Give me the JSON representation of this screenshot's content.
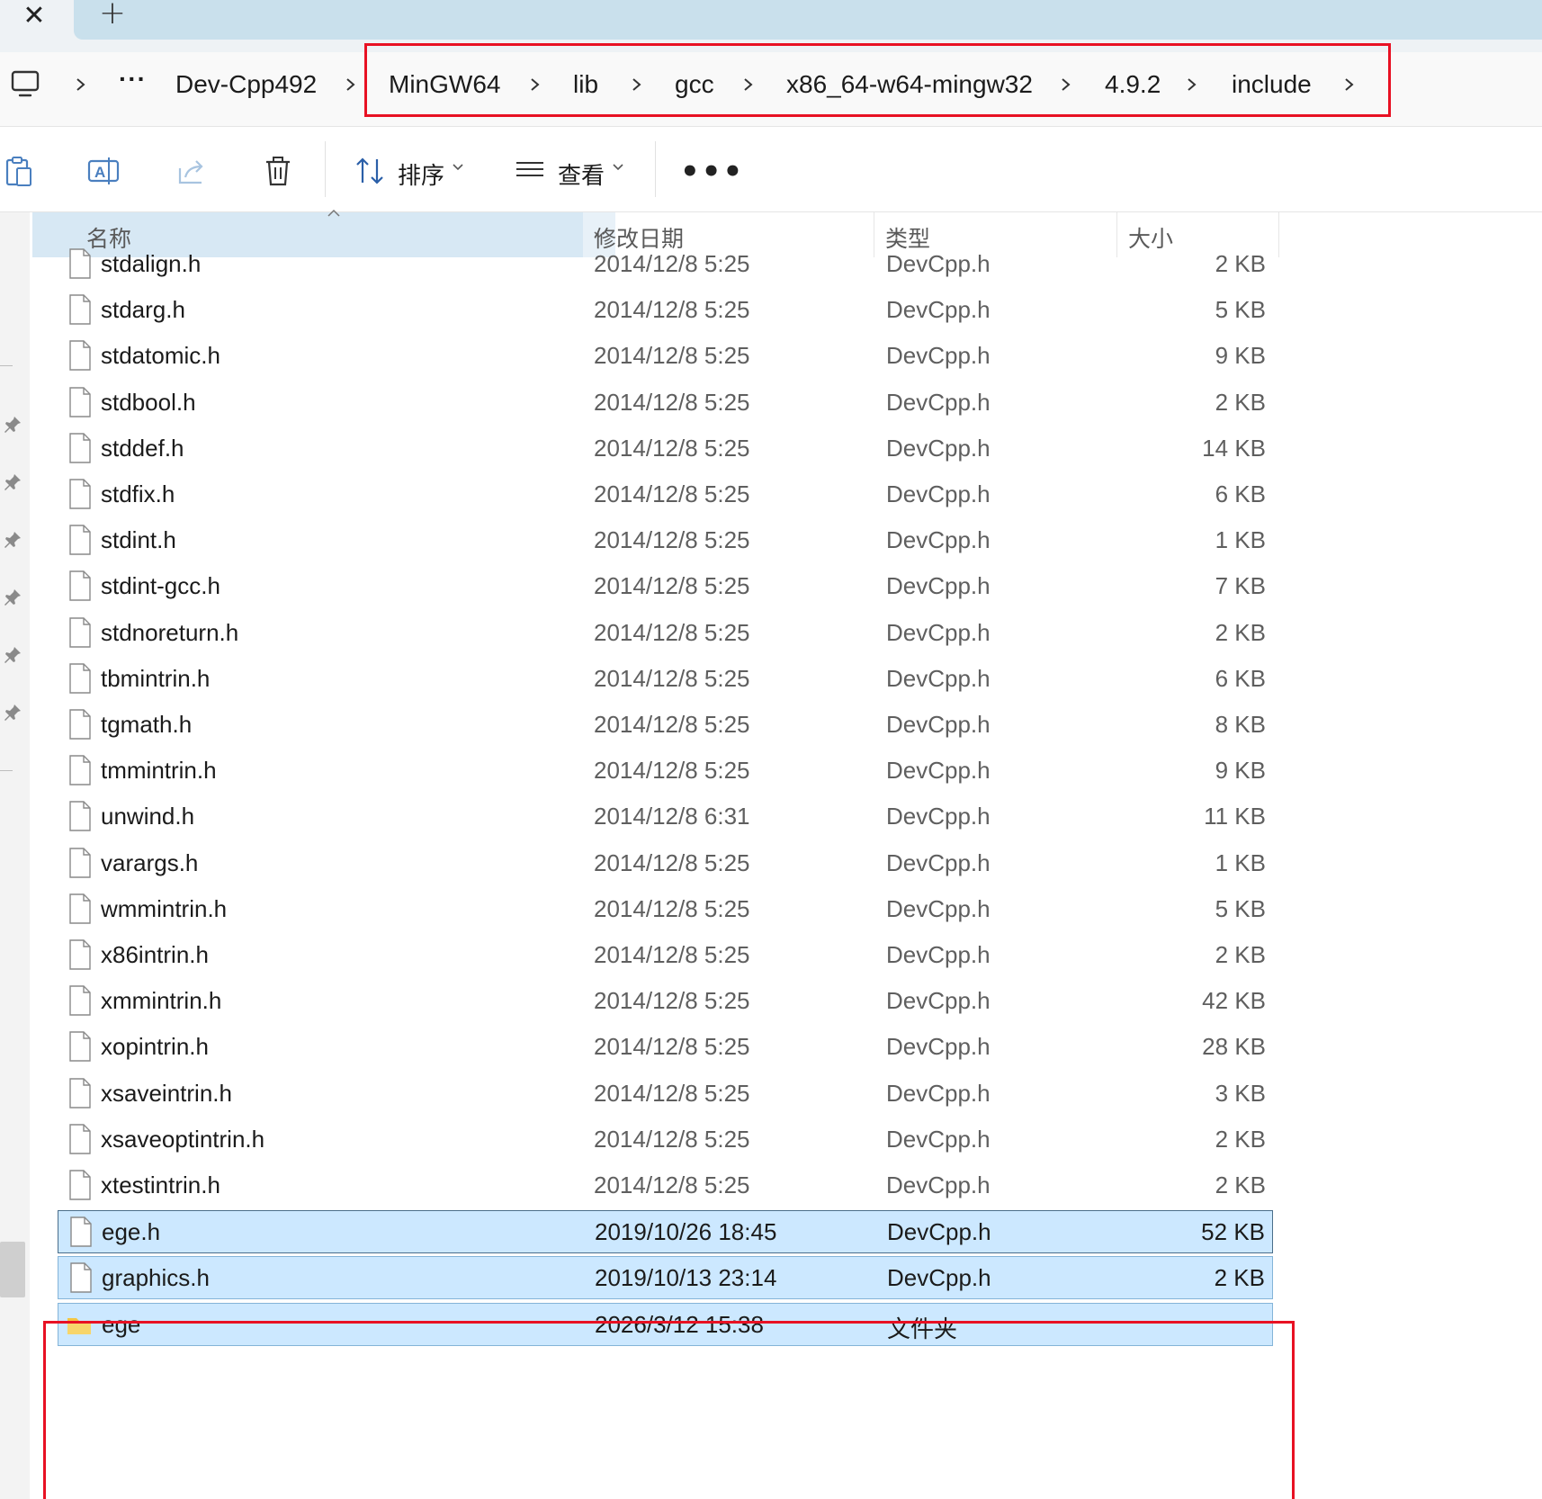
{
  "tabs": {
    "close_glyph": "✕",
    "add_glyph": "+"
  },
  "breadcrumb": {
    "items": [
      "Dev-Cpp492",
      "MinGW64",
      "lib",
      "gcc",
      "x86_64-w64-mingw32",
      "4.9.2",
      "include"
    ],
    "overflow": "···",
    "highlight_color": "#e81123"
  },
  "toolbar": {
    "sort_label": "排序",
    "view_label": "查看",
    "more_label": "•••"
  },
  "columns": {
    "name": "名称",
    "date": "修改日期",
    "type": "类型",
    "size": "大小"
  },
  "files": [
    {
      "name": "stdalign.h",
      "date": "2014/12/8 5:25",
      "type": "DevCpp.h",
      "size": "2 KB"
    },
    {
      "name": "stdarg.h",
      "date": "2014/12/8 5:25",
      "type": "DevCpp.h",
      "size": "5 KB"
    },
    {
      "name": "stdatomic.h",
      "date": "2014/12/8 5:25",
      "type": "DevCpp.h",
      "size": "9 KB"
    },
    {
      "name": "stdbool.h",
      "date": "2014/12/8 5:25",
      "type": "DevCpp.h",
      "size": "2 KB"
    },
    {
      "name": "stddef.h",
      "date": "2014/12/8 5:25",
      "type": "DevCpp.h",
      "size": "14 KB"
    },
    {
      "name": "stdfix.h",
      "date": "2014/12/8 5:25",
      "type": "DevCpp.h",
      "size": "6 KB"
    },
    {
      "name": "stdint.h",
      "date": "2014/12/8 5:25",
      "type": "DevCpp.h",
      "size": "1 KB"
    },
    {
      "name": "stdint-gcc.h",
      "date": "2014/12/8 5:25",
      "type": "DevCpp.h",
      "size": "7 KB"
    },
    {
      "name": "stdnoreturn.h",
      "date": "2014/12/8 5:25",
      "type": "DevCpp.h",
      "size": "2 KB"
    },
    {
      "name": "tbmintrin.h",
      "date": "2014/12/8 5:25",
      "type": "DevCpp.h",
      "size": "6 KB"
    },
    {
      "name": "tgmath.h",
      "date": "2014/12/8 5:25",
      "type": "DevCpp.h",
      "size": "8 KB"
    },
    {
      "name": "tmmintrin.h",
      "date": "2014/12/8 5:25",
      "type": "DevCpp.h",
      "size": "9 KB"
    },
    {
      "name": "unwind.h",
      "date": "2014/12/8 6:31",
      "type": "DevCpp.h",
      "size": "11 KB"
    },
    {
      "name": "varargs.h",
      "date": "2014/12/8 5:25",
      "type": "DevCpp.h",
      "size": "1 KB"
    },
    {
      "name": "wmmintrin.h",
      "date": "2014/12/8 5:25",
      "type": "DevCpp.h",
      "size": "5 KB"
    },
    {
      "name": "x86intrin.h",
      "date": "2014/12/8 5:25",
      "type": "DevCpp.h",
      "size": "2 KB"
    },
    {
      "name": "xmmintrin.h",
      "date": "2014/12/8 5:25",
      "type": "DevCpp.h",
      "size": "42 KB"
    },
    {
      "name": "xopintrin.h",
      "date": "2014/12/8 5:25",
      "type": "DevCpp.h",
      "size": "28 KB"
    },
    {
      "name": "xsaveintrin.h",
      "date": "2014/12/8 5:25",
      "type": "DevCpp.h",
      "size": "3 KB"
    },
    {
      "name": "xsaveoptintrin.h",
      "date": "2014/12/8 5:25",
      "type": "DevCpp.h",
      "size": "2 KB"
    },
    {
      "name": "xtestintrin.h",
      "date": "2014/12/8 5:25",
      "type": "DevCpp.h",
      "size": "2 KB"
    },
    {
      "name": "ege.h",
      "date": "2019/10/26 18:45",
      "type": "DevCpp.h",
      "size": "52 KB",
      "selected": "focused"
    },
    {
      "name": "graphics.h",
      "date": "2019/10/13 23:14",
      "type": "DevCpp.h",
      "size": "2 KB",
      "selected": "yes"
    },
    {
      "name": "ege",
      "date": "2026/3/12 15:38",
      "type": "文件夹",
      "size": "",
      "selected": "yes",
      "folder": "yes"
    }
  ],
  "colors": {
    "selection_bg": "#cce8ff",
    "header_bg": "#d7e8f4",
    "tab_bg": "#c9e0ec",
    "folder_yellow": "#f4c542"
  }
}
